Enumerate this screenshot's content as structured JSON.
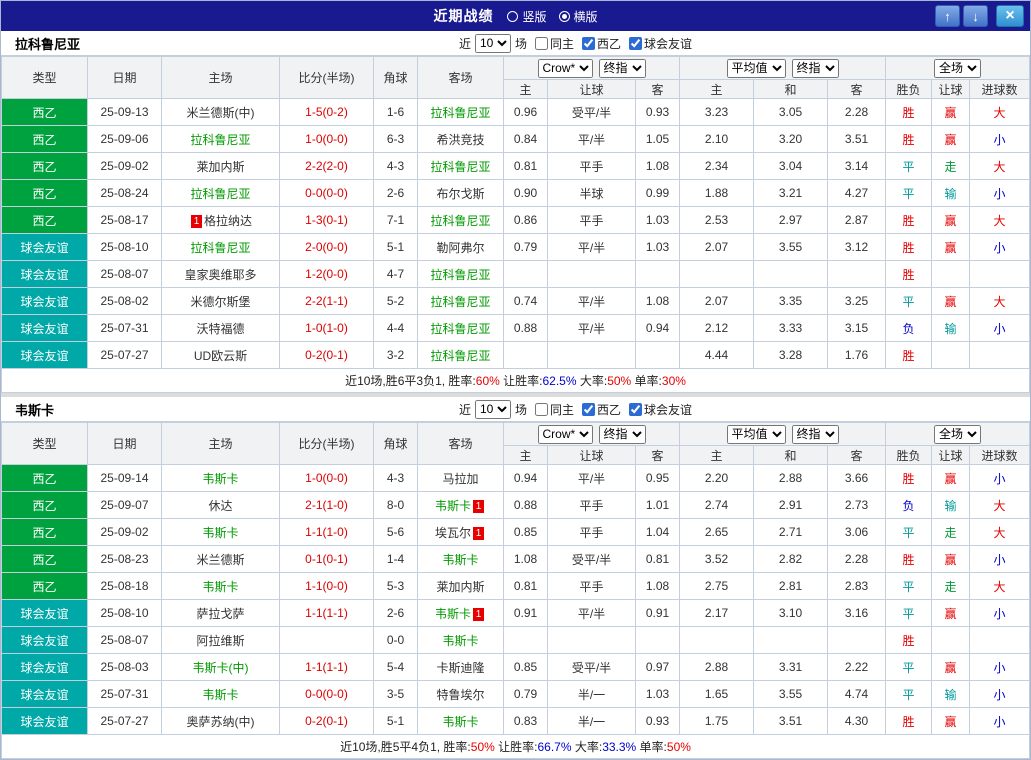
{
  "titlebar": {
    "title": "近期战绩",
    "vertical_label": "竖版",
    "horizontal_label": "横版",
    "vertical_selected": false,
    "horizontal_selected": true,
    "up_icon": "↑",
    "down_icon": "↓",
    "close_icon": "×"
  },
  "labels": {
    "near": "近",
    "matches": "场",
    "same_home": "同主",
    "league": "西乙",
    "friendly": "球会友谊"
  },
  "columns": {
    "type": "类型",
    "date": "日期",
    "home": "主场",
    "score": "比分(半场)",
    "corner": "角球",
    "away": "客场",
    "o_home": "主",
    "o_hcp": "让球",
    "o_away": "客",
    "a_home": "主",
    "a_draw": "和",
    "a_away": "客",
    "wdl": "胜负",
    "hcp_result": "让球",
    "goals": "进球数"
  },
  "type_colors": {
    "西乙": "#00a23f",
    "球会友谊": "#00a8a8"
  },
  "result_colors": {
    "胜": "#e60000",
    "平": "#009999",
    "负": "#0000cc",
    "赢": "#e60000",
    "走": "#009933",
    "输": "#009999",
    "大": "#e60000",
    "小": "#0000cc"
  },
  "tables": [
    {
      "team": "拉科鲁尼亚",
      "filter": {
        "rounds": "10",
        "same_home": false,
        "league": true,
        "friendly": true
      },
      "selects": {
        "odds_source": "Crow*",
        "odds_final": "终指",
        "avg_source": "平均值",
        "avg_final": "终指",
        "scope": "全场"
      },
      "rows": [
        {
          "type": "西乙",
          "date": "25-09-13",
          "home": {
            "name": "米兰德斯(中)"
          },
          "score": "1-5(0-2)",
          "corner": "1-6",
          "away": {
            "name": "拉科鲁尼亚",
            "focus": true
          },
          "odds": [
            "0.96",
            "受平/半",
            "0.93"
          ],
          "avg": [
            "3.23",
            "3.05",
            "2.28"
          ],
          "results": [
            "胜",
            "赢",
            "大"
          ]
        },
        {
          "type": "西乙",
          "date": "25-09-06",
          "home": {
            "name": "拉科鲁尼亚",
            "focus": true
          },
          "score": "1-0(0-0)",
          "corner": "6-3",
          "away": {
            "name": "希洪竞技"
          },
          "odds": [
            "0.84",
            "平/半",
            "1.05"
          ],
          "avg": [
            "2.10",
            "3.20",
            "3.51"
          ],
          "results": [
            "胜",
            "赢",
            "小"
          ]
        },
        {
          "type": "西乙",
          "date": "25-09-02",
          "home": {
            "name": "莱加内斯"
          },
          "score": "2-2(2-0)",
          "corner": "4-3",
          "away": {
            "name": "拉科鲁尼亚",
            "focus": true
          },
          "odds": [
            "0.81",
            "平手",
            "1.08"
          ],
          "avg": [
            "2.34",
            "3.04",
            "3.14"
          ],
          "results": [
            "平",
            "走",
            "大"
          ]
        },
        {
          "type": "西乙",
          "date": "25-08-24",
          "home": {
            "name": "拉科鲁尼亚",
            "focus": true
          },
          "score": "0-0(0-0)",
          "corner": "2-6",
          "away": {
            "name": "布尔戈斯"
          },
          "odds": [
            "0.90",
            "半球",
            "0.99"
          ],
          "avg": [
            "1.88",
            "3.21",
            "4.27"
          ],
          "results": [
            "平",
            "输",
            "小"
          ]
        },
        {
          "type": "西乙",
          "date": "25-08-17",
          "home": {
            "name": "格拉纳达",
            "badge": "1",
            "badge_side": "left"
          },
          "score": "1-3(0-1)",
          "corner": "7-1",
          "away": {
            "name": "拉科鲁尼亚",
            "focus": true
          },
          "odds": [
            "0.86",
            "平手",
            "1.03"
          ],
          "avg": [
            "2.53",
            "2.97",
            "2.87"
          ],
          "results": [
            "胜",
            "赢",
            "大"
          ]
        },
        {
          "type": "球会友谊",
          "date": "25-08-10",
          "home": {
            "name": "拉科鲁尼亚",
            "focus": true
          },
          "score": "2-0(0-0)",
          "corner": "5-1",
          "away": {
            "name": "勒阿弗尔"
          },
          "odds": [
            "0.79",
            "平/半",
            "1.03"
          ],
          "avg": [
            "2.07",
            "3.55",
            "3.12"
          ],
          "results": [
            "胜",
            "赢",
            "小"
          ]
        },
        {
          "type": "球会友谊",
          "date": "25-08-07",
          "home": {
            "name": "皇家奥维耶多"
          },
          "score": "1-2(0-0)",
          "corner": "4-7",
          "away": {
            "name": "拉科鲁尼亚",
            "focus": true
          },
          "odds": [
            "",
            "",
            ""
          ],
          "avg": [
            "",
            "",
            ""
          ],
          "results": [
            "胜",
            "",
            ""
          ]
        },
        {
          "type": "球会友谊",
          "date": "25-08-02",
          "home": {
            "name": "米德尔斯堡"
          },
          "score": "2-2(1-1)",
          "corner": "5-2",
          "away": {
            "name": "拉科鲁尼亚",
            "focus": true
          },
          "odds": [
            "0.74",
            "平/半",
            "1.08"
          ],
          "avg": [
            "2.07",
            "3.35",
            "3.25"
          ],
          "results": [
            "平",
            "赢",
            "大"
          ]
        },
        {
          "type": "球会友谊",
          "date": "25-07-31",
          "home": {
            "name": "沃特福德"
          },
          "score": "1-0(1-0)",
          "corner": "4-4",
          "away": {
            "name": "拉科鲁尼亚",
            "focus": true
          },
          "odds": [
            "0.88",
            "平/半",
            "0.94"
          ],
          "avg": [
            "2.12",
            "3.33",
            "3.15"
          ],
          "results": [
            "负",
            "输",
            "小"
          ]
        },
        {
          "type": "球会友谊",
          "date": "25-07-27",
          "home": {
            "name": "UD欧云斯"
          },
          "score": "0-2(0-1)",
          "corner": "3-2",
          "away": {
            "name": "拉科鲁尼亚",
            "focus": true
          },
          "odds": [
            "",
            "",
            ""
          ],
          "avg": [
            "4.44",
            "3.28",
            "1.76"
          ],
          "results": [
            "胜",
            "",
            ""
          ]
        }
      ],
      "summary": [
        {
          "text": "近10场,胜6平3负1, 胜率:",
          "color": "#222222"
        },
        {
          "text": "60%",
          "color": "#e60000"
        },
        {
          "text": " 让胜率:",
          "color": "#222222"
        },
        {
          "text": "62.5%",
          "color": "#0000cc"
        },
        {
          "text": " 大率:",
          "color": "#222222"
        },
        {
          "text": "50%",
          "color": "#e60000"
        },
        {
          "text": " 单率:",
          "color": "#222222"
        },
        {
          "text": "30%",
          "color": "#e60000"
        }
      ]
    },
    {
      "team": "韦斯卡",
      "filter": {
        "rounds": "10",
        "same_home": false,
        "league": true,
        "friendly": true
      },
      "selects": {
        "odds_source": "Crow*",
        "odds_final": "终指",
        "avg_source": "平均值",
        "avg_final": "终指",
        "scope": "全场"
      },
      "rows": [
        {
          "type": "西乙",
          "date": "25-09-14",
          "home": {
            "name": "韦斯卡",
            "focus": true
          },
          "score": "1-0(0-0)",
          "corner": "4-3",
          "away": {
            "name": "马拉加"
          },
          "odds": [
            "0.94",
            "平/半",
            "0.95"
          ],
          "avg": [
            "2.20",
            "2.88",
            "3.66"
          ],
          "results": [
            "胜",
            "赢",
            "小"
          ]
        },
        {
          "type": "西乙",
          "date": "25-09-07",
          "home": {
            "name": "休达"
          },
          "score": "2-1(1-0)",
          "corner": "8-0",
          "away": {
            "name": "韦斯卡",
            "focus": true,
            "badge": "1",
            "badge_side": "right"
          },
          "odds": [
            "0.88",
            "平手",
            "1.01"
          ],
          "avg": [
            "2.74",
            "2.91",
            "2.73"
          ],
          "results": [
            "负",
            "输",
            "大"
          ]
        },
        {
          "type": "西乙",
          "date": "25-09-02",
          "home": {
            "name": "韦斯卡",
            "focus": true
          },
          "score": "1-1(1-0)",
          "corner": "5-6",
          "away": {
            "name": "埃瓦尔",
            "badge": "1",
            "badge_side": "right"
          },
          "odds": [
            "0.85",
            "平手",
            "1.04"
          ],
          "avg": [
            "2.65",
            "2.71",
            "3.06"
          ],
          "results": [
            "平",
            "走",
            "大"
          ]
        },
        {
          "type": "西乙",
          "date": "25-08-23",
          "home": {
            "name": "米兰德斯"
          },
          "score": "0-1(0-1)",
          "corner": "1-4",
          "away": {
            "name": "韦斯卡",
            "focus": true
          },
          "odds": [
            "1.08",
            "受平/半",
            "0.81"
          ],
          "avg": [
            "3.52",
            "2.82",
            "2.28"
          ],
          "results": [
            "胜",
            "赢",
            "小"
          ]
        },
        {
          "type": "西乙",
          "date": "25-08-18",
          "home": {
            "name": "韦斯卡",
            "focus": true
          },
          "score": "1-1(0-0)",
          "corner": "5-3",
          "away": {
            "name": "莱加内斯"
          },
          "odds": [
            "0.81",
            "平手",
            "1.08"
          ],
          "avg": [
            "2.75",
            "2.81",
            "2.83"
          ],
          "results": [
            "平",
            "走",
            "大"
          ]
        },
        {
          "type": "球会友谊",
          "date": "25-08-10",
          "home": {
            "name": "萨拉戈萨"
          },
          "score": "1-1(1-1)",
          "corner": "2-6",
          "away": {
            "name": "韦斯卡",
            "focus": true,
            "badge": "1",
            "badge_side": "right"
          },
          "odds": [
            "0.91",
            "平/半",
            "0.91"
          ],
          "avg": [
            "2.17",
            "3.10",
            "3.16"
          ],
          "results": [
            "平",
            "赢",
            "小"
          ]
        },
        {
          "type": "球会友谊",
          "date": "25-08-07",
          "home": {
            "name": "阿拉维斯"
          },
          "score": "",
          "corner": "0-0",
          "away": {
            "name": "韦斯卡",
            "focus": true
          },
          "odds": [
            "",
            "",
            ""
          ],
          "avg": [
            "",
            "",
            ""
          ],
          "results": [
            "胜",
            "",
            ""
          ]
        },
        {
          "type": "球会友谊",
          "date": "25-08-03",
          "home": {
            "name": "韦斯卡(中)",
            "focus": true
          },
          "score": "1-1(1-1)",
          "corner": "5-4",
          "away": {
            "name": "卡斯迪隆"
          },
          "odds": [
            "0.85",
            "受平/半",
            "0.97"
          ],
          "avg": [
            "2.88",
            "3.31",
            "2.22"
          ],
          "results": [
            "平",
            "赢",
            "小"
          ]
        },
        {
          "type": "球会友谊",
          "date": "25-07-31",
          "home": {
            "name": "韦斯卡",
            "focus": true
          },
          "score": "0-0(0-0)",
          "corner": "3-5",
          "away": {
            "name": "特鲁埃尔"
          },
          "odds": [
            "0.79",
            "半/一",
            "1.03"
          ],
          "avg": [
            "1.65",
            "3.55",
            "4.74"
          ],
          "results": [
            "平",
            "输",
            "小"
          ]
        },
        {
          "type": "球会友谊",
          "date": "25-07-27",
          "home": {
            "name": "奥萨苏纳(中)"
          },
          "score": "0-2(0-1)",
          "corner": "5-1",
          "away": {
            "name": "韦斯卡",
            "focus": true
          },
          "odds": [
            "0.83",
            "半/一",
            "0.93"
          ],
          "avg": [
            "1.75",
            "3.51",
            "4.30"
          ],
          "results": [
            "胜",
            "赢",
            "小"
          ]
        }
      ],
      "summary": [
        {
          "text": "近10场,胜5平4负1, 胜率:",
          "color": "#222222"
        },
        {
          "text": "50%",
          "color": "#e60000"
        },
        {
          "text": " 让胜率:",
          "color": "#222222"
        },
        {
          "text": "66.7%",
          "color": "#0000cc"
        },
        {
          "text": " 大率:",
          "color": "#222222"
        },
        {
          "text": "33.3%",
          "color": "#0000cc"
        },
        {
          "text": " 单率:",
          "color": "#222222"
        },
        {
          "text": "50%",
          "color": "#e60000"
        }
      ]
    }
  ]
}
